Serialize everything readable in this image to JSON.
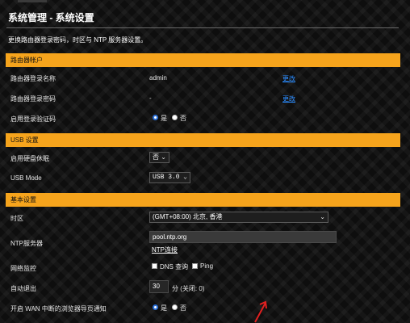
{
  "header": {
    "title": "系统管理 - 系统设置",
    "description": "更换路由器登录密码，时区与 NTP 服务器设置。"
  },
  "sections": {
    "router_account": "路由器帐户",
    "usb": "USB 设置",
    "basic": "基本设置"
  },
  "router_account": {
    "login_name_label": "路由器登录名称",
    "login_name_value": "admin",
    "login_name_change": "更改",
    "password_label": "路由器登录密码",
    "password_value": "-",
    "password_change": "更改",
    "captcha_label": "启用登录验证码",
    "captcha_yes": "是",
    "captcha_no": "否",
    "captcha_selected": "是"
  },
  "usb": {
    "hdd_sleep_label": "启用硬盘休眠",
    "hdd_sleep_value": "否",
    "usb_mode_label": "USB Mode",
    "usb_mode_value": "USB 3.0"
  },
  "basic": {
    "timezone_label": "时区",
    "timezone_value": "(GMT+08:00) 北京, 香港",
    "ntp_label": "NTP服务器",
    "ntp_value": "pool.ntp.org",
    "ntp_link": "NTP连接",
    "netmon_label": "网络监控",
    "netmon_dns": "DNS 查询",
    "netmon_ping": "Ping",
    "autologout_label": "自动退出",
    "autologout_value": "30",
    "autologout_unit": "分 (关闭: 0)",
    "wan_notify_label": "开启 WAN 中断的浏览器导页通知",
    "wan_notify_yes": "是",
    "wan_notify_no": "否",
    "wan_notify_selected": "是"
  },
  "colors": {
    "section_bg": "#f6a41c",
    "link": "#2b8cff",
    "annotation_arrow": "#e02020"
  }
}
